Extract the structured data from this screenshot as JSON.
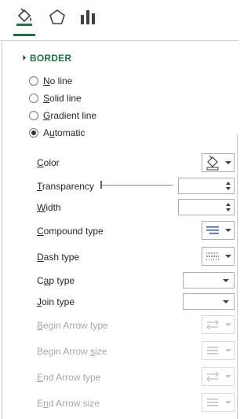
{
  "tabs": [
    {
      "icon": "fill-line-icon",
      "active": true
    },
    {
      "icon": "effects-pentagon-icon",
      "active": false
    },
    {
      "icon": "size-properties-icon",
      "active": false
    }
  ],
  "section": {
    "title": "BORDER",
    "expanded": true
  },
  "line_options": [
    {
      "accel": "N",
      "rest": "o line",
      "checked": false
    },
    {
      "accel": "S",
      "rest": "olid line",
      "checked": false
    },
    {
      "accel": "G",
      "rest": "radient line",
      "checked": false
    },
    {
      "accel": "u",
      "pre": "A",
      "rest": "tomatic",
      "checked": true
    }
  ],
  "props": {
    "color": {
      "pre": "",
      "accel": "C",
      "rest": "olor",
      "icon": "paint-bucket-icon"
    },
    "transparency": {
      "pre": "",
      "accel": "T",
      "rest": "ransparency",
      "value": "",
      "slider_percent": 0
    },
    "width": {
      "pre": "",
      "accel": "W",
      "rest": "idth",
      "value": ""
    },
    "compound": {
      "pre": "",
      "accel": "C",
      "rest": "ompound type",
      "icon": "compound-lines-icon"
    },
    "dash": {
      "pre": "",
      "accel": "D",
      "rest": "ash type",
      "icon": "dash-lines-icon"
    },
    "cap": {
      "pre": "C",
      "accel": "a",
      "rest": "p type",
      "value": ""
    },
    "join": {
      "pre": "",
      "accel": "J",
      "rest": "oin type",
      "value": ""
    },
    "begin_arrow_type": {
      "pre": "",
      "accel": "B",
      "rest": "egin Arrow type",
      "icon": "arrow-type-icon",
      "disabled": true
    },
    "begin_arrow_size": {
      "pre": "Begin Arrow ",
      "accel": "s",
      "rest": "ize",
      "icon": "arrow-size-icon",
      "disabled": true
    },
    "end_arrow_type": {
      "pre": "",
      "accel": "E",
      "rest": "nd Arrow type",
      "icon": "arrow-type-icon",
      "disabled": true
    },
    "end_arrow_size": {
      "pre": "E",
      "accel": "n",
      "rest": "d Arrow size",
      "icon": "arrow-size-icon",
      "disabled": true
    }
  },
  "colors": {
    "accent": "#217346",
    "disabled_text": "#a6a6a6"
  }
}
